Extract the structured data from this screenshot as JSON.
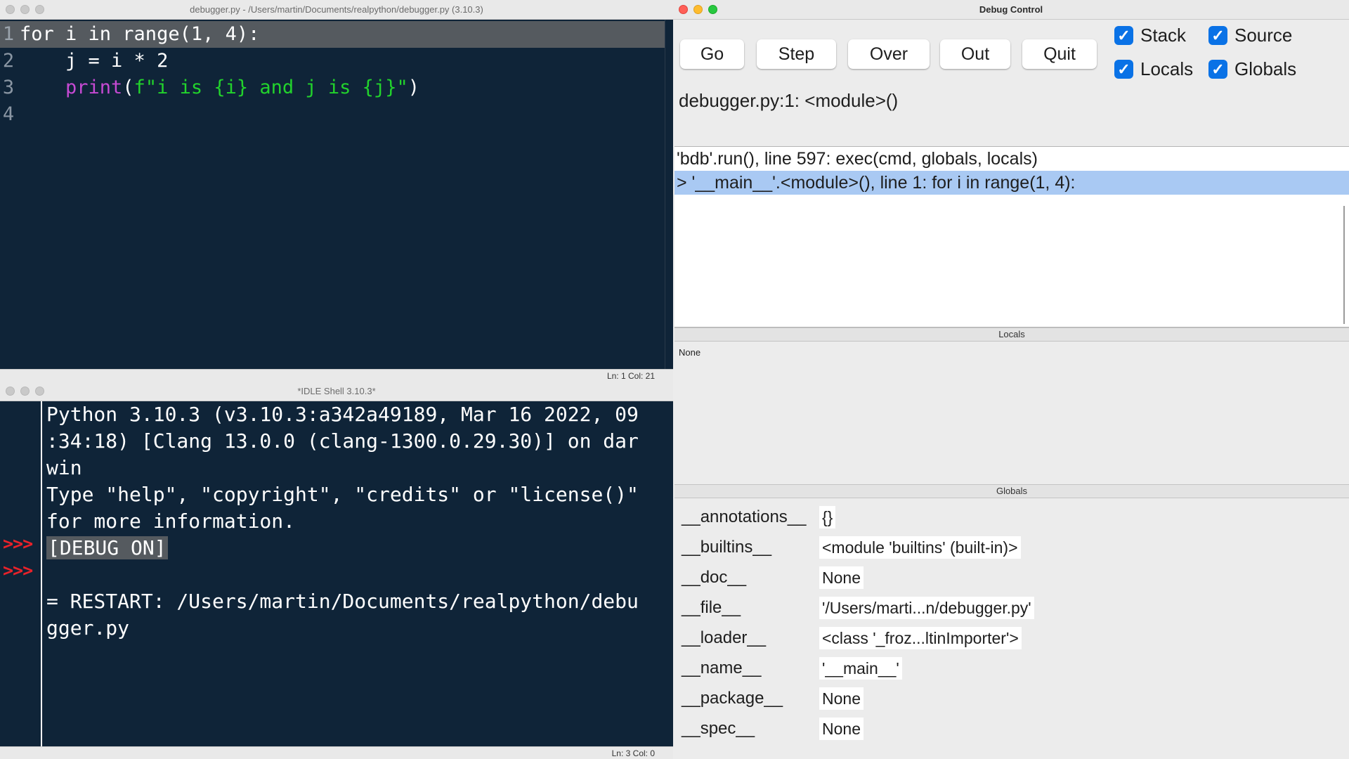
{
  "editor": {
    "title": "debugger.py - /Users/martin/Documents/realpython/debugger.py (3.10.3)",
    "lines": [
      {
        "num": "1",
        "code": "for i in range(1, 4):"
      },
      {
        "num": "2",
        "code": "    j = i * 2"
      },
      {
        "num": "3",
        "code": "    print(f\"i is {i} and j is {j}\")",
        "parts": [
          "    ",
          "print",
          "(",
          "f\"i is {i} and j is {j}\"",
          ")"
        ]
      },
      {
        "num": "4",
        "code": ""
      }
    ],
    "status": "Ln: 1   Col: 21"
  },
  "shell": {
    "title": "*IDLE Shell 3.10.3*",
    "prompt": ">>>",
    "lines": [
      "Python 3.10.3 (v3.10.3:a342a49189, Mar 16 2022, 09",
      ":34:18) [Clang 13.0.0 (clang-1300.0.29.30)] on dar",
      "win",
      "Type \"help\", \"copyright\", \"credits\" or \"license()\"",
      "for more information.",
      "[DEBUG ON]",
      "",
      "= RESTART: /Users/martin/Documents/realpython/debu",
      "gger.py"
    ],
    "status": "Ln: 3   Col: 0"
  },
  "debug": {
    "title": "Debug Control",
    "buttons": {
      "go": "Go",
      "step": "Step",
      "over": "Over",
      "out": "Out",
      "quit": "Quit"
    },
    "checkboxes": {
      "stack": "Stack",
      "source": "Source",
      "locals": "Locals",
      "globals": "Globals"
    },
    "checked": {
      "stack": true,
      "source": true,
      "locals": true,
      "globals": true
    },
    "status": "debugger.py:1: <module>()",
    "stack": [
      "'bdb'.run(), line 597: exec(cmd, globals, locals)",
      "> '__main__'.<module>(), line 1: for i in range(1, 4):"
    ],
    "locals_label": "Locals",
    "locals_value": "None",
    "globals_label": "Globals",
    "globals": [
      {
        "key": "__annotations__",
        "value": "{}"
      },
      {
        "key": "__builtins__",
        "value": "<module 'builtins' (built-in)>"
      },
      {
        "key": "__doc__",
        "value": "None"
      },
      {
        "key": "__file__",
        "value": "'/Users/marti...n/debugger.py'"
      },
      {
        "key": "__loader__",
        "value": "<class '_froz...ltinImporter'>"
      },
      {
        "key": "__name__",
        "value": "'__main__'"
      },
      {
        "key": "__package__",
        "value": "None"
      },
      {
        "key": "__spec__",
        "value": "None"
      }
    ]
  },
  "colors": {
    "editor_bg": "#0f2438",
    "keyword_purple": "#c64ad3",
    "string_green": "#22d32c",
    "prompt_red": "#e8222a",
    "selection_blue": "#a9c9f3",
    "checkbox_blue": "#0a72e6"
  }
}
